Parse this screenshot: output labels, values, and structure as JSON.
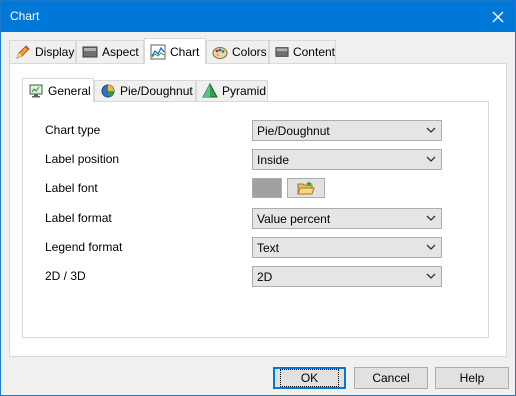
{
  "window": {
    "title": "Chart",
    "close_icon": "close-icon"
  },
  "tabs": [
    {
      "label": "Display",
      "icon": "pencil-icon",
      "active": false
    },
    {
      "label": "Aspect",
      "icon": "panel-icon",
      "active": false
    },
    {
      "label": "Chart",
      "icon": "line-chart-icon",
      "active": true
    },
    {
      "label": "Colors",
      "icon": "palette-icon",
      "active": false
    },
    {
      "label": "Content",
      "icon": "panel-icon",
      "active": false
    }
  ],
  "subtabs": [
    {
      "label": "General",
      "icon": "monitor-icon",
      "active": true
    },
    {
      "label": "Pie/Doughnut",
      "icon": "pie-icon",
      "active": false
    },
    {
      "label": "Pyramid",
      "icon": "pyramid-icon",
      "active": false
    }
  ],
  "fields": {
    "chart_type": {
      "label": "Chart type",
      "value": "Pie/Doughnut"
    },
    "label_position": {
      "label": "Label position",
      "value": "Inside"
    },
    "label_font": {
      "label": "Label font",
      "swatch_color": "#a0a0a0"
    },
    "label_format": {
      "label": "Label format",
      "value": "Value percent"
    },
    "legend_format": {
      "label": "Legend format",
      "value": "Text"
    },
    "dimension": {
      "label": "2D / 3D",
      "value": "2D"
    }
  },
  "buttons": {
    "ok": "OK",
    "cancel": "Cancel",
    "help": "Help"
  },
  "colors": {
    "titlebar": "#0078d7",
    "focus_border": "#0078d7"
  }
}
